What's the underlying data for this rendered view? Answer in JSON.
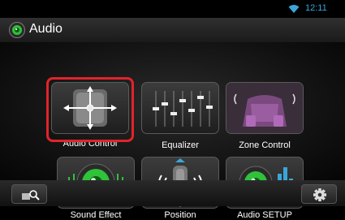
{
  "status": {
    "time": "12:11",
    "wifi_icon": "wifi-icon"
  },
  "header": {
    "title": "Audio",
    "icon": "audio-app-icon"
  },
  "tiles": [
    {
      "label": "Audio Control",
      "icon": "audio-control-icon"
    },
    {
      "label": "Equalizer",
      "icon": "equalizer-icon"
    },
    {
      "label": "Zone Control",
      "icon": "zone-control-icon"
    },
    {
      "label": "Sound Effect",
      "icon": "sound-effect-icon"
    },
    {
      "label": "Position",
      "icon": "position-icon"
    },
    {
      "label": "Audio SETUP",
      "icon": "audio-setup-icon"
    }
  ],
  "bottom": {
    "left_icon": "source-search-icon",
    "right_icon": "settings-gear-icon"
  },
  "colors": {
    "accent": "#3aa6d8",
    "highlight": "#e2232a",
    "speaker_green": "#2fc23a"
  }
}
